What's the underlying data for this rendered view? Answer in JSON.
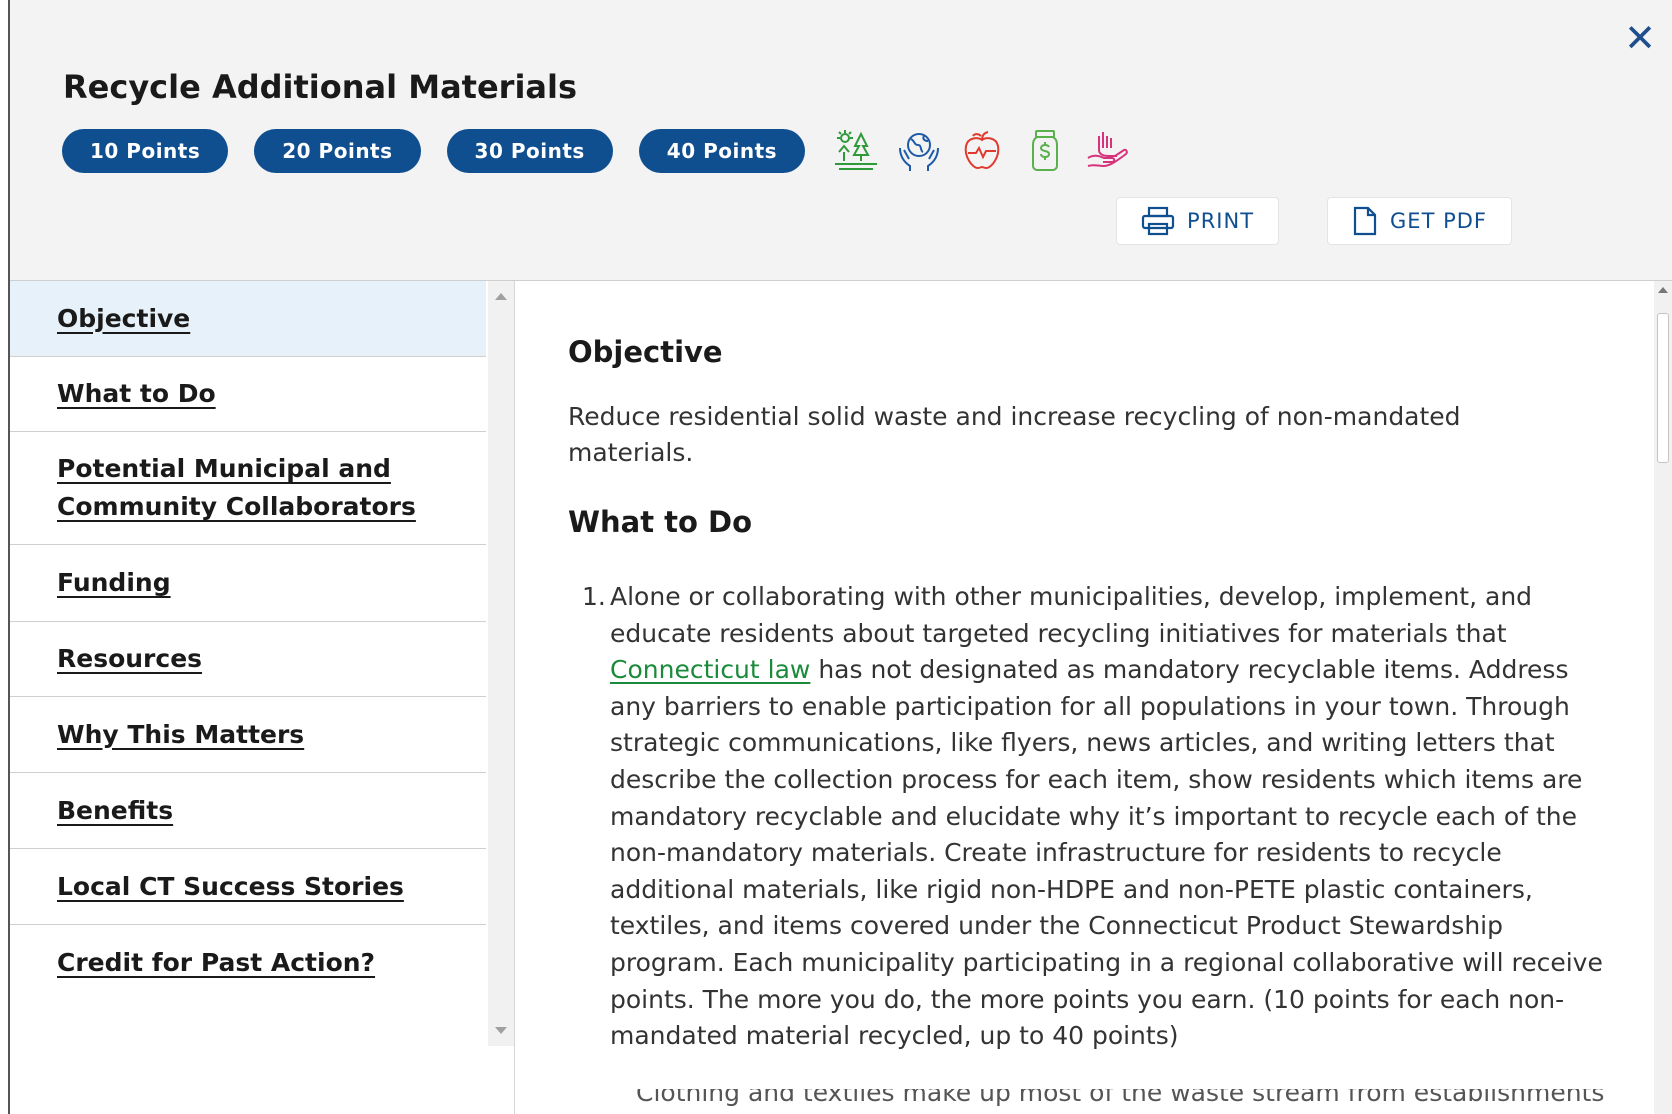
{
  "header": {
    "title": "Recycle Additional Materials",
    "points": [
      "10 Points",
      "20 Points",
      "30 Points",
      "40 Points"
    ],
    "category_icons": [
      {
        "name": "nature-icon",
        "color": "#2e9a3a"
      },
      {
        "name": "globe-hands-icon",
        "color": "#1e5aa8"
      },
      {
        "name": "apple-health-icon",
        "color": "#e03a2e"
      },
      {
        "name": "money-jar-icon",
        "color": "#5bb04e"
      },
      {
        "name": "helping-hand-icon",
        "color": "#d6337a"
      }
    ],
    "print_label": "PRINT",
    "pdf_label": "GET PDF",
    "close_icon": "close-icon"
  },
  "sidebar": {
    "items": [
      {
        "label": "Objective",
        "active": true
      },
      {
        "label": "What to Do",
        "active": false
      },
      {
        "label": "Potential Municipal and",
        "label2": "Community Collaborators",
        "active": false
      },
      {
        "label": "Funding",
        "active": false
      },
      {
        "label": "Resources",
        "active": false
      },
      {
        "label": "Why This Matters",
        "active": false
      },
      {
        "label": "Benefits",
        "active": false
      },
      {
        "label": "Local CT Success Stories",
        "active": false
      },
      {
        "label": "Credit for Past Action?",
        "active": false
      }
    ]
  },
  "content": {
    "objective_heading": "Objective",
    "objective_text": "Reduce residential solid waste and increase recycling of non-mandated materials.",
    "what_heading": "What to Do",
    "item1_number": "1.",
    "item1_before_link": "Alone or collaborating with other municipalities, develop, implement, and educate residents about targeted recycling initiatives for materials that ",
    "item1_link": "Connecticut law",
    "item1_after_link": " has not designated as mandatory recyclable items. Address any barriers to enable participation for all populations in your town. Through strategic communications, like flyers, news articles, and writing letters that describe the collection process for each item, show residents which items are mandatory recyclable and elucidate why it’s important to recycle each of the non-mandatory materials. Create infrastructure for residents to recycle additional materials, like rigid non-HDPE and non-PETE plastic containers, textiles, and items covered under the Connecticut Product Stewardship program. Each municipality participating in a regional collaborative will receive points. The more you do, the more points you earn. (10 points for each non-mandated material recycled, up to 40 points)",
    "cutoff_text": "Clothing and textiles make up most of the waste stream from establishments that"
  },
  "colors": {
    "accent": "#0f4e8f",
    "link": "#1b8a3a",
    "active_nav": "#e6f1f9",
    "header_bg": "#f3f3f3"
  }
}
